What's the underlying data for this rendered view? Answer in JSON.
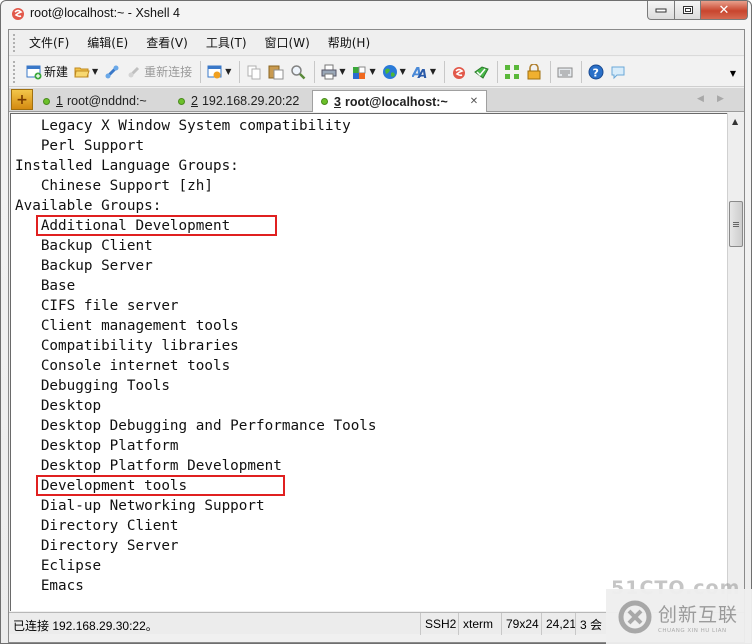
{
  "window": {
    "title": "root@localhost:~ - Xshell 4",
    "controls": {
      "minimize": "minimize",
      "maximize": "maximize",
      "close": "close"
    }
  },
  "menu": [
    {
      "label": "文件(F)"
    },
    {
      "label": "编辑(E)"
    },
    {
      "label": "查看(V)"
    },
    {
      "label": "工具(T)"
    },
    {
      "label": "窗口(W)"
    },
    {
      "label": "帮助(H)"
    }
  ],
  "toolbar": {
    "new_label": "新建",
    "reconnect_label": "重新连接",
    "icons": [
      "new-session-icon",
      "open-folder-icon",
      "connect-icon",
      "reconnect-icon",
      "properties-icon",
      "copy-icon",
      "paste-icon",
      "find-icon",
      "print-icon",
      "transfer-icon",
      "globe-icon",
      "font-icon",
      "xshell-icon",
      "xftp-icon",
      "fullscreen-icon",
      "lock-icon",
      "keyboard-icon",
      "help-icon",
      "chat-icon"
    ]
  },
  "tabs": [
    {
      "num": "1",
      "label": "root@nddnd:~",
      "active": false,
      "status_color": "#6cc12a"
    },
    {
      "num": "2",
      "label": "192.168.29.20:22",
      "active": false,
      "status_color": "#6cc12a"
    },
    {
      "num": "3",
      "label": "root@localhost:~",
      "active": true,
      "status_color": "#6cc12a"
    }
  ],
  "terminal": {
    "lines": [
      "   Legacy X Window System compatibility",
      "   Perl Support",
      "Installed Language Groups:",
      "   Chinese Support [zh]",
      "Available Groups:",
      "   Additional Development",
      "   Backup Client",
      "   Backup Server",
      "   Base",
      "   CIFS file server",
      "   Client management tools",
      "   Compatibility libraries",
      "   Console internet tools",
      "   Debugging Tools",
      "   Desktop",
      "   Desktop Debugging and Performance Tools",
      "   Desktop Platform",
      "   Desktop Platform Development",
      "   Development tools",
      "   Dial-up Networking Support",
      "   Directory Client",
      "   Directory Server",
      "   Eclipse",
      "   Emacs"
    ],
    "highlighted_lines": [
      5,
      18
    ],
    "highlight_color": "#e02020"
  },
  "statusbar": {
    "connection": "已连接 192.168.29.30:22。",
    "protocol": "SSH2",
    "term_type": "xterm",
    "size": "79x24",
    "cursor": "24,21",
    "sessions": "3 会"
  },
  "watermark": {
    "site": "51CTO.com",
    "brand_cn": "创新互联",
    "brand_en": "CHUANG XIN HU LIAN"
  }
}
